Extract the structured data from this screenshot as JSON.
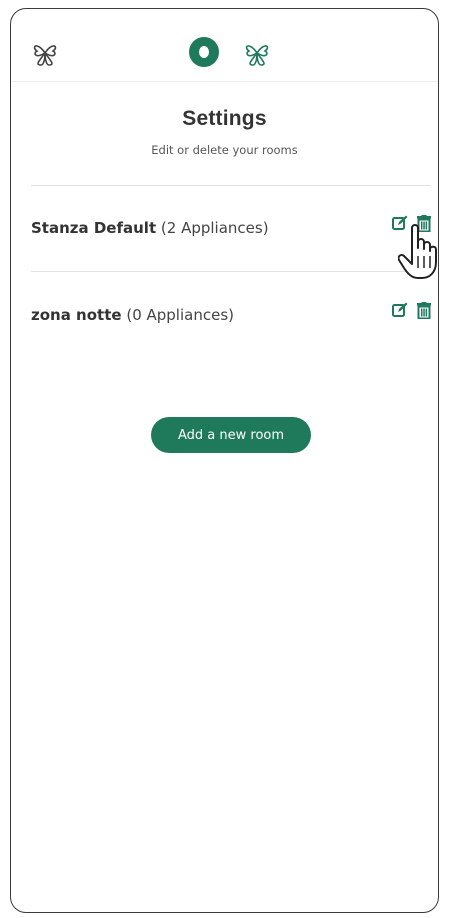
{
  "colors": {
    "accent": "#1f7a5c",
    "text": "#333333",
    "muted": "#555555",
    "divider": "#e2e2e2"
  },
  "topbar": {
    "left_icon": "clover-logo-icon",
    "center_icon": "info-dot-icon",
    "right_icon": "clover-logo-icon"
  },
  "header": {
    "title": "Settings",
    "subtitle": "Edit or delete your rooms"
  },
  "rooms": [
    {
      "name": "Stanza Default",
      "count": "(2 Appliances)"
    },
    {
      "name": "zona notte",
      "count": "(0 Appliances)"
    }
  ],
  "actions": {
    "edit_icon": "edit-icon",
    "delete_icon": "trash-icon"
  },
  "add_button": {
    "label": "Add a new room"
  }
}
